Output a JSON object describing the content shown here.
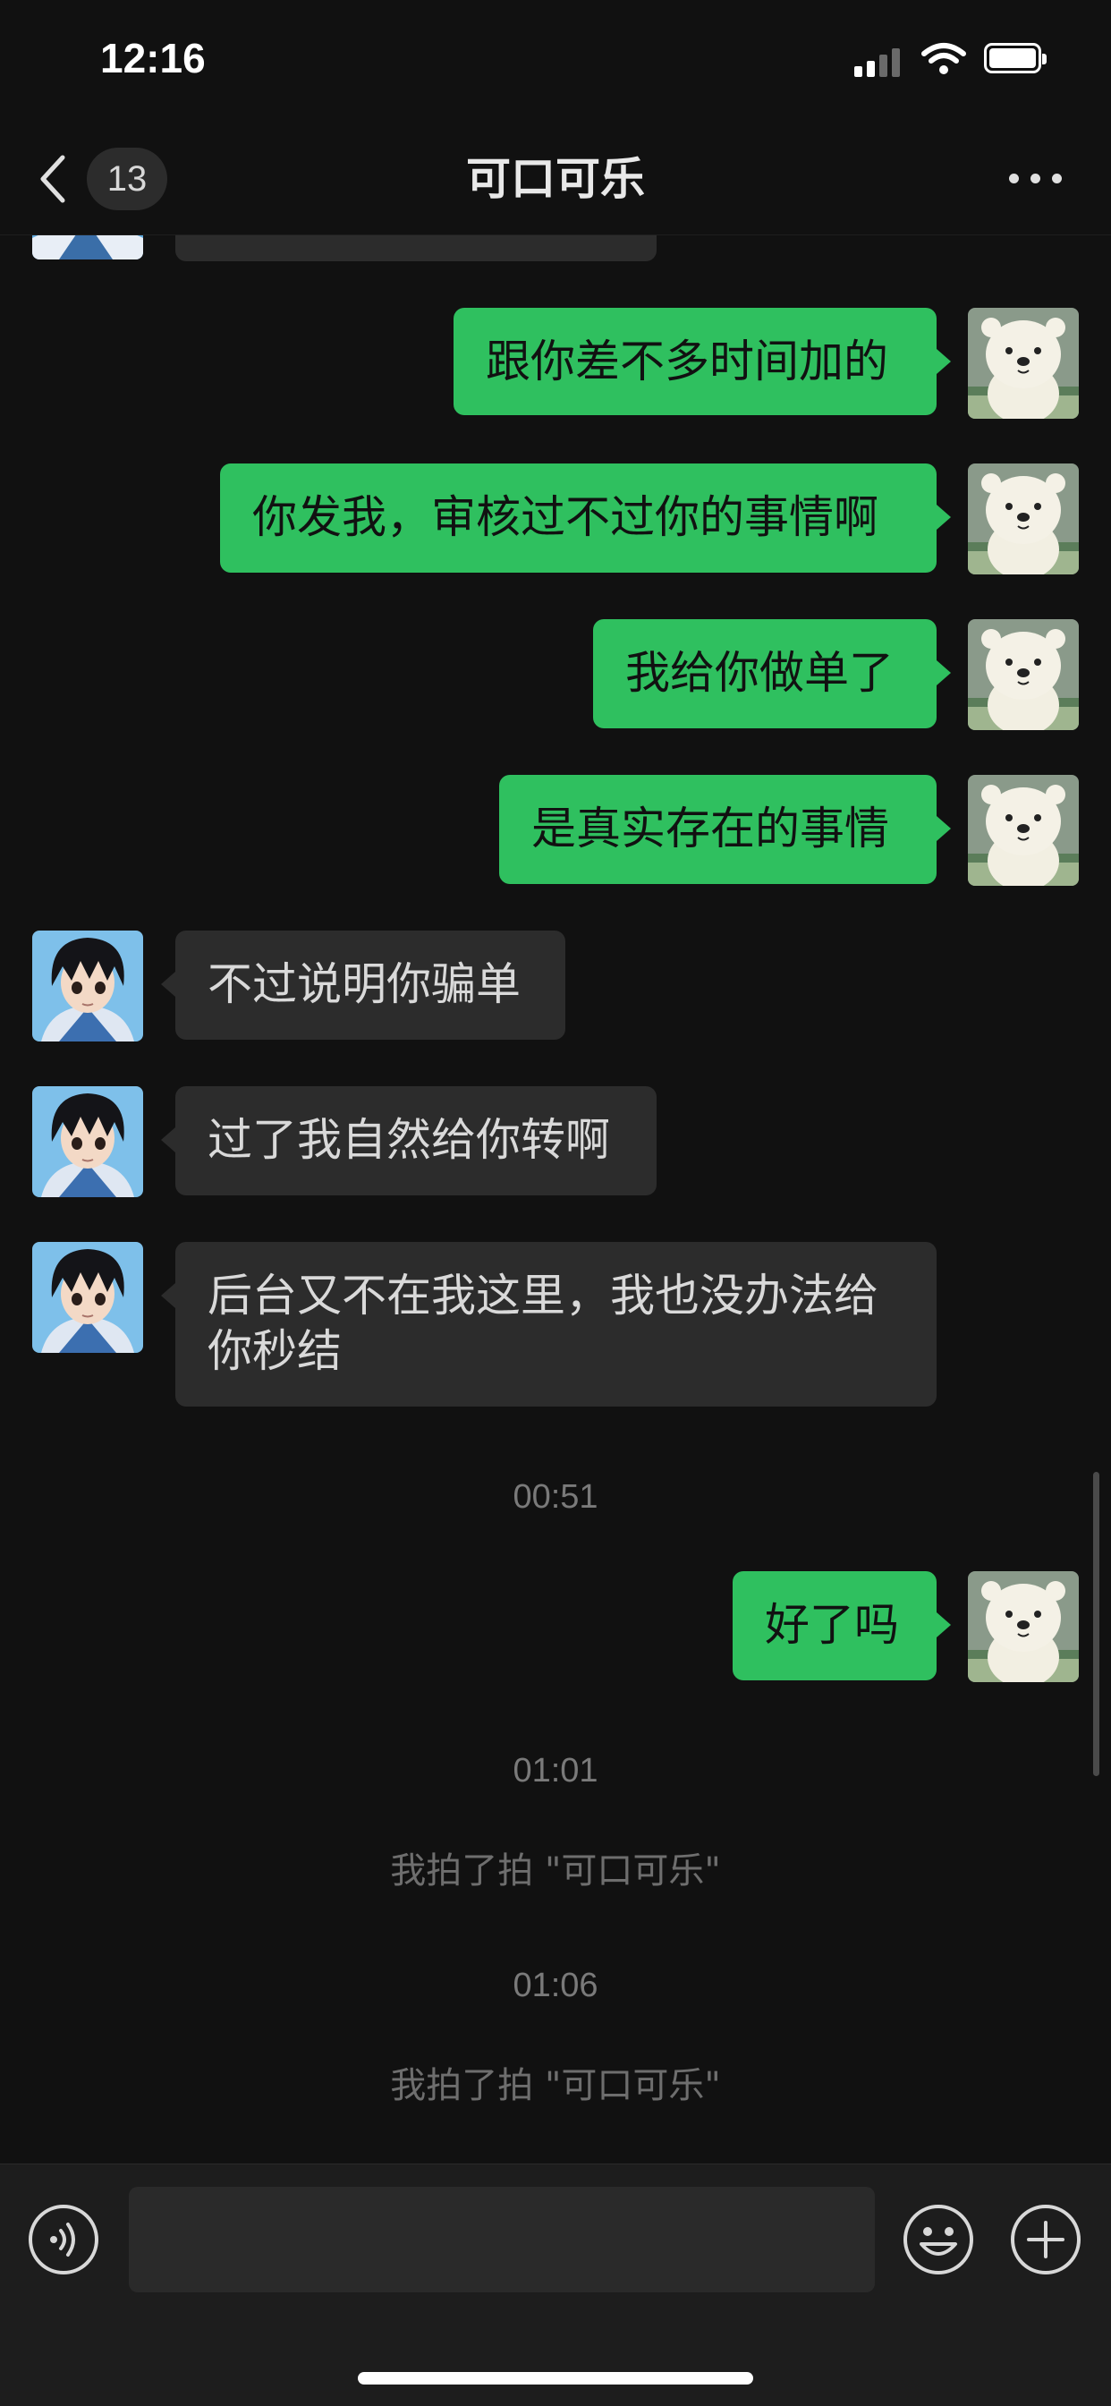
{
  "status_bar": {
    "time": "12:16"
  },
  "nav": {
    "unread_count": "13",
    "title": "可口可乐"
  },
  "messages": [
    {
      "id": "m1",
      "side": "out",
      "text": "跟你差不多时间加的"
    },
    {
      "id": "m2",
      "side": "out",
      "text": "你发我，审核过不过你的事情啊"
    },
    {
      "id": "m3",
      "side": "out",
      "text": "我给你做单了"
    },
    {
      "id": "m4",
      "side": "out",
      "text": "是真实存在的事情"
    },
    {
      "id": "m5",
      "side": "in",
      "text": "不过说明你骗单"
    },
    {
      "id": "m6",
      "side": "in",
      "text": "过了我自然给你转啊"
    },
    {
      "id": "m7",
      "side": "in",
      "text": "后台又不在我这里，我也没办法给你秒结"
    },
    {
      "id": "t1",
      "type": "timestamp",
      "text": "00:51"
    },
    {
      "id": "m8",
      "side": "out",
      "text": "好了吗"
    },
    {
      "id": "t2",
      "type": "timestamp",
      "text": "01:01"
    },
    {
      "id": "s1",
      "type": "system",
      "text": "我拍了拍 \"可口可乐\""
    },
    {
      "id": "t3",
      "type": "timestamp",
      "text": "01:06"
    },
    {
      "id": "s2",
      "type": "system",
      "text": "我拍了拍 \"可口可乐\""
    }
  ],
  "input_bar": {
    "text_value": ""
  },
  "colors": {
    "outgoing_bubble": "#2fc05f",
    "incoming_bubble": "#2c2c2c",
    "background": "#111111"
  },
  "icons": [
    "back-chevron-icon",
    "more-icon",
    "voice-icon",
    "emoji-icon",
    "plus-icon",
    "polar-bear-avatar",
    "anime-boy-avatar"
  ]
}
